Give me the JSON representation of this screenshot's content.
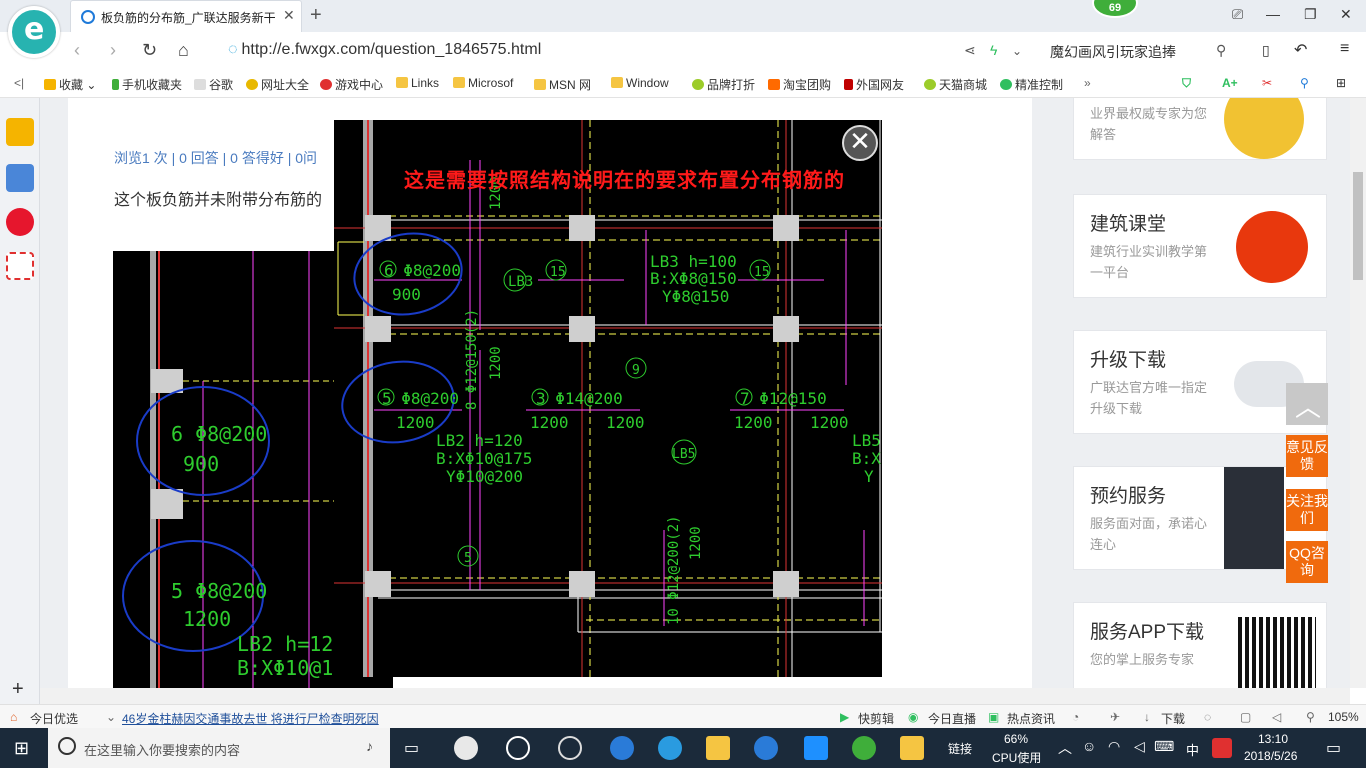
{
  "browser": {
    "tab_title": "板负筋的分布筋_广联达服务新干",
    "badge_count": "69",
    "url": "http://e.fwxgx.com/question_1846575.html",
    "search_text": "魔幻画风引玩家追捧"
  },
  "favorites": [
    {
      "label": "收藏",
      "color": "#f5b400"
    },
    {
      "label": "手机收藏夹",
      "color": "#3fae3a"
    },
    {
      "label": "谷歌",
      "color": "#cccccc"
    },
    {
      "label": "网址大全",
      "color": "#e8b800"
    },
    {
      "label": "游戏中心",
      "color": "#e03030"
    },
    {
      "label": "Links",
      "color": "#f5c542"
    },
    {
      "label": "Microsof",
      "color": "#f5c542"
    },
    {
      "label": "MSN 网",
      "color": "#f5c542"
    },
    {
      "label": "Window",
      "color": "#f5c542"
    },
    {
      "label": "品牌打折",
      "color": "#9ccc2a"
    },
    {
      "label": "淘宝团购",
      "color": "#ff6a00"
    },
    {
      "label": "外国网友",
      "color": "#c00000"
    },
    {
      "label": "天猫商城",
      "color": "#9ccc2a"
    },
    {
      "label": "精准控制",
      "color": "#2fbf5f"
    }
  ],
  "page": {
    "meta": "浏览1 次 | 0 回答 | 0 答得好 | 0问",
    "description": "这个板负筋并未附带分布筋的",
    "sidebar_cards": [
      {
        "title": "",
        "sub": "业界最权威专家为您解答"
      },
      {
        "title": "建筑课堂",
        "sub": "建筑行业实训教学第一平台"
      },
      {
        "title": "升级下载",
        "sub": "广联达官方唯一指定升级下载"
      },
      {
        "title": "预约服务",
        "sub": "服务面对面，承诺心连心"
      },
      {
        "title": "服务APP下载",
        "sub": "您的掌上服务专家"
      }
    ]
  },
  "overlay": {
    "caption": "这是需要按照结构说明在的要求布置分布钢筋的",
    "annotations": {
      "lb3": "LB3 h=100",
      "lb3_bx": "B:XΦ8@150",
      "lb3_by": "YΦ8@150",
      "lb2": "LB2 h=120",
      "lb2_bx": "B:XΦ10@175",
      "lb2_by": "YΦ10@200",
      "lb5": "LB5",
      "lb5_bx": "B:X",
      "lb5_by": "Y",
      "r6": "6 Φ8@200",
      "r6_len": "900",
      "r5": "5 Φ8@200",
      "r5_len": "1200",
      "r3": "3 Φ14@200",
      "r7": "7 Φ12@150",
      "r8": "8 Φ12@150(2)",
      "r10": "10 Φ12@200(2)",
      "len1200": "1200",
      "c15": "15",
      "c9": "9",
      "c5": "5",
      "lb3_tag": "LB3",
      "lb5_tag": "LB5"
    }
  },
  "side_buttons": {
    "feedback": "意见反馈",
    "follow": "关注我们",
    "qq": "QQ咨询"
  },
  "statusbar": {
    "today": "今日优选",
    "news": "46岁金柱赫因交通事故去世 将进行尸检查明死因",
    "items": [
      "快剪辑",
      "今日直播",
      "热点资讯",
      "下载"
    ],
    "zoom": "105%"
  },
  "taskbar": {
    "search_placeholder": "在这里输入你要搜索的内容",
    "link_label": "链接",
    "cpu_percent": "66%",
    "cpu_label": "CPU使用",
    "ime": "中",
    "time": "13:10",
    "date": "2018/5/26"
  }
}
